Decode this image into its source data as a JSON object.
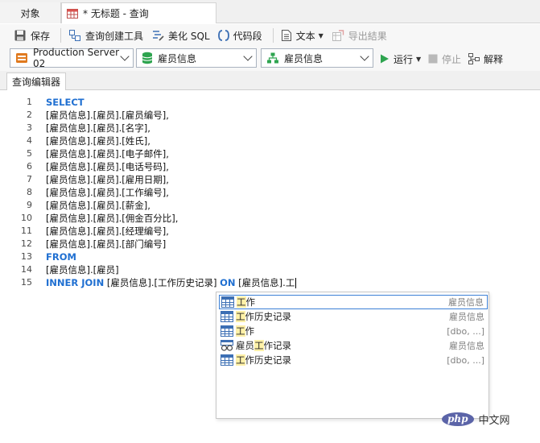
{
  "tabs": {
    "objects_label": "对象",
    "query_label": "* 无标题 - 查询"
  },
  "toolbar": {
    "save_label": "保存",
    "query_builder_label": "查询创建工具",
    "beautify_label": "美化 SQL",
    "snippet_label": "代码段",
    "text_label": "文本",
    "export_label": "导出結果"
  },
  "selectors": {
    "connection": "Production Server 02",
    "database": "雇员信息",
    "schema": "雇员信息"
  },
  "actions": {
    "run_label": "运行",
    "stop_label": "停止",
    "explain_label": "解释"
  },
  "editor": {
    "tab_label": "查询编辑器",
    "line_numbers": [
      "1",
      "2",
      "3",
      "4",
      "5",
      "6",
      "7",
      "8",
      "9",
      "10",
      "11",
      "12",
      "13",
      "14",
      "15"
    ],
    "lines": [
      {
        "kw": "SELECT",
        "text": ""
      },
      {
        "kw": "",
        "text": "[雇员信息].[雇员].[雇员编号],"
      },
      {
        "kw": "",
        "text": "[雇员信息].[雇员].[名字],"
      },
      {
        "kw": "",
        "text": "[雇员信息].[雇员].[姓氏],"
      },
      {
        "kw": "",
        "text": "[雇员信息].[雇员].[电子邮件],"
      },
      {
        "kw": "",
        "text": "[雇员信息].[雇员].[电话号码],"
      },
      {
        "kw": "",
        "text": "[雇员信息].[雇员].[雇用日期],"
      },
      {
        "kw": "",
        "text": "[雇员信息].[雇员].[工作编号],"
      },
      {
        "kw": "",
        "text": "[雇员信息].[雇员].[薪金],"
      },
      {
        "kw": "",
        "text": "[雇员信息].[雇员].[佣金百分比],"
      },
      {
        "kw": "",
        "text": "[雇员信息].[雇员].[经理编号],"
      },
      {
        "kw": "",
        "text": "[雇员信息].[雇员].[部门编号]"
      },
      {
        "kw": "FROM",
        "text": ""
      },
      {
        "kw": "",
        "text": "[雇员信息].[雇员]"
      }
    ],
    "line15": {
      "kw1": "INNER JOIN",
      "part1": " [雇员信息].[工作历史记录] ",
      "kw2": "ON",
      "part2": " [雇员信息].工"
    }
  },
  "autocomplete": {
    "items": [
      {
        "pre": "",
        "hl": "工",
        "post": "作",
        "context": "雇员信息",
        "icon": "table-icon"
      },
      {
        "pre": "",
        "hl": "工",
        "post": "作历史记录",
        "context": "雇员信息",
        "icon": "table-icon"
      },
      {
        "pre": "",
        "hl": "工",
        "post": "作",
        "context": "[dbo, ...]",
        "icon": "table-icon"
      },
      {
        "pre": "雇员",
        "hl": "工",
        "post": "作记录",
        "context": "雇员信息",
        "icon": "view-icon"
      },
      {
        "pre": "",
        "hl": "工",
        "post": "作历史记录",
        "context": "[dbo, ...]",
        "icon": "table-icon"
      }
    ]
  },
  "watermark": {
    "logo": "php",
    "text": "中文网"
  },
  "colors": {
    "keyword": "#1f6fd1",
    "selection_border": "#3c80d6",
    "highlight": "#fff1a8"
  }
}
